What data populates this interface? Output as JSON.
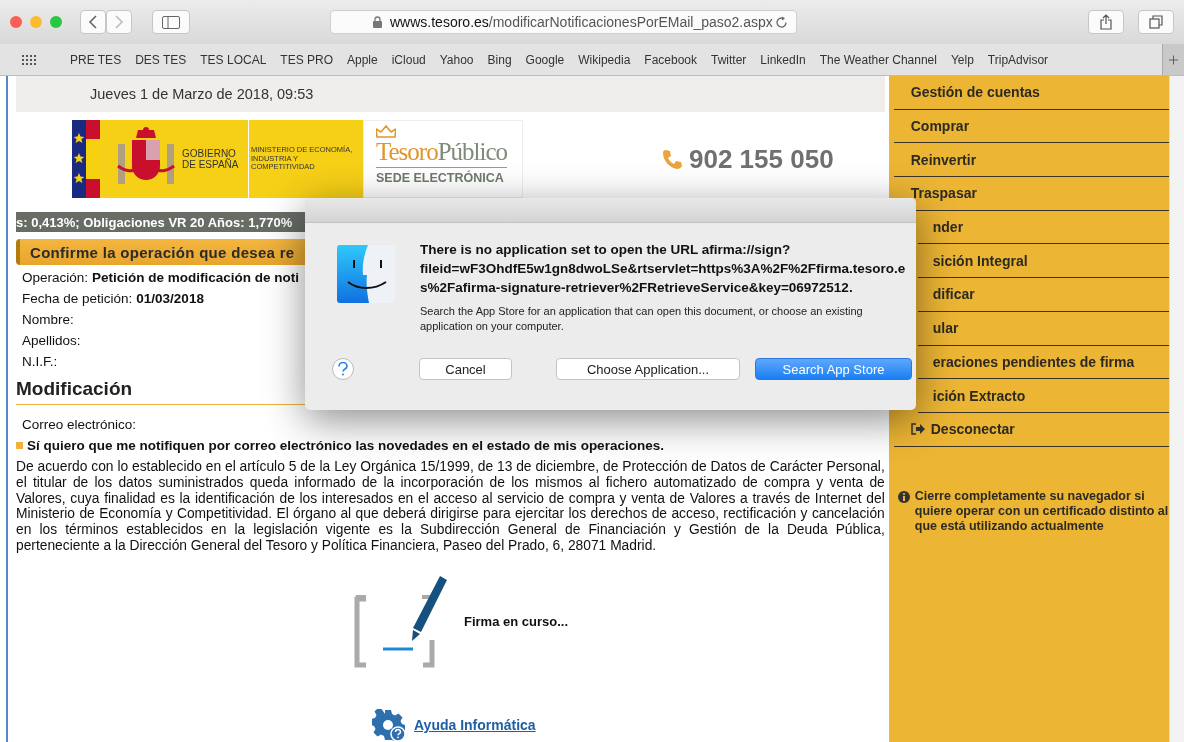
{
  "browser": {
    "url_domain": "wwws.tesoro.es",
    "url_path": "/modificarNotificacionesPorEMail_paso2.aspx",
    "bookmarks": [
      "PRE TES",
      "DES TES",
      "TES LOCAL",
      "TES PRO",
      "Apple",
      "iCloud",
      "Yahoo",
      "Bing",
      "Google",
      "Wikipedia",
      "Facebook",
      "Twitter",
      "LinkedIn",
      "The Weather Channel",
      "Yelp",
      "TripAdvisor"
    ]
  },
  "page": {
    "date": "Jueves 1 de Marzo de 2018, 09:53",
    "gobierno": "GOBIERNO DE ESPAÑA",
    "ministerio": "MINISTERIO DE ECONOMÍA, INDUSTRIA Y COMPETITIVIDAD",
    "brand": [
      "Tesoro",
      "Público"
    ],
    "brand_subtitle": "SEDE ELECTRÓNICA",
    "phone": "902 155 050",
    "ticker": "s: 0,413%; Obligaciones VR 20 Años: 1,770%",
    "confirm_title": "Confirme la operación que desea re",
    "fields": [
      {
        "label": "Operación:",
        "value": "Petición de modificación de noti"
      },
      {
        "label": "Fecha de petición:",
        "value": "01/03/2018"
      },
      {
        "label": "Nombre:"
      },
      {
        "label": "Apellidos:"
      },
      {
        "label": "N.I.F.:"
      }
    ],
    "section_title": "Modificación",
    "email_label": "Correo electrónico:",
    "notify_option": "Sí quiero que me notifiquen por correo electrónico las novedades en el estado de mis operaciones.",
    "legal_text": "De acuerdo con lo establecido en el artículo 5 de la Ley Orgánica 15/1999, de 13 de diciembre, de Protección de Datos de Carácter Personal, el titular de los datos suministrados queda informado de la incorporación de los mismos al fichero automatizado de compra y venta de Valores, cuya finalidad es la identificación de los interesados en el acceso al servicio de compra y venta de Valores a través de Internet del Ministerio de Economía y Competitividad. El órgano al que deberá dirigirse para ejercitar los derechos de acceso, rectificación y cancelación en los términos establecidos en la legislación vigente es la Subdirección General de Financiación y Gestión de la Deuda Pública, perteneciente a la Dirección General del Tesoro y Política Financiera, Paseo del Prado, 6, 28071 Madrid.",
    "signing_status": "Firma en curso...",
    "help_link": "Ayuda Informática"
  },
  "sidebar": {
    "items": [
      {
        "label": "Gestión de cuentas",
        "kind": "link",
        "covered": false
      },
      {
        "label": "Comprar",
        "kind": "link",
        "covered": false
      },
      {
        "label": "Reinvertir",
        "kind": "link",
        "covered": false
      },
      {
        "label": "Traspasar",
        "kind": "link",
        "covered": false
      },
      {
        "label": "nder",
        "kind": "link",
        "covered": true
      },
      {
        "label": "sición Integral",
        "kind": "link",
        "covered": true
      },
      {
        "label": "dificar",
        "kind": "link",
        "covered": true
      },
      {
        "label": "ular",
        "kind": "link",
        "covered": true
      },
      {
        "label": "eraciones pendientes de firma",
        "kind": "link",
        "covered": true
      },
      {
        "label": "ición Extracto",
        "kind": "link",
        "covered": true
      },
      {
        "label": "Desconectar",
        "kind": "logout",
        "covered": false
      }
    ],
    "notice": "Cierre completamente su navegador si quiere operar con un certificado distinto al que está utilizando actualmente"
  },
  "dialog": {
    "message": "There is no application set to open the URL afirma://sign?fileid=wF3OhdfE5w1gn8dwoLSe&rtservlet=https%3A%2F%2Ffirma.tesoro.es%2Fafirma-signature-retriever%2FRetrieveService&key=06972512.",
    "detail": "Search the App Store for an application that can open this document, or choose an existing application on your computer.",
    "buttons": [
      {
        "label": "Cancel",
        "default": false
      },
      {
        "label": "Choose Application...",
        "default": false
      },
      {
        "label": "Search App Store",
        "default": true
      }
    ]
  }
}
